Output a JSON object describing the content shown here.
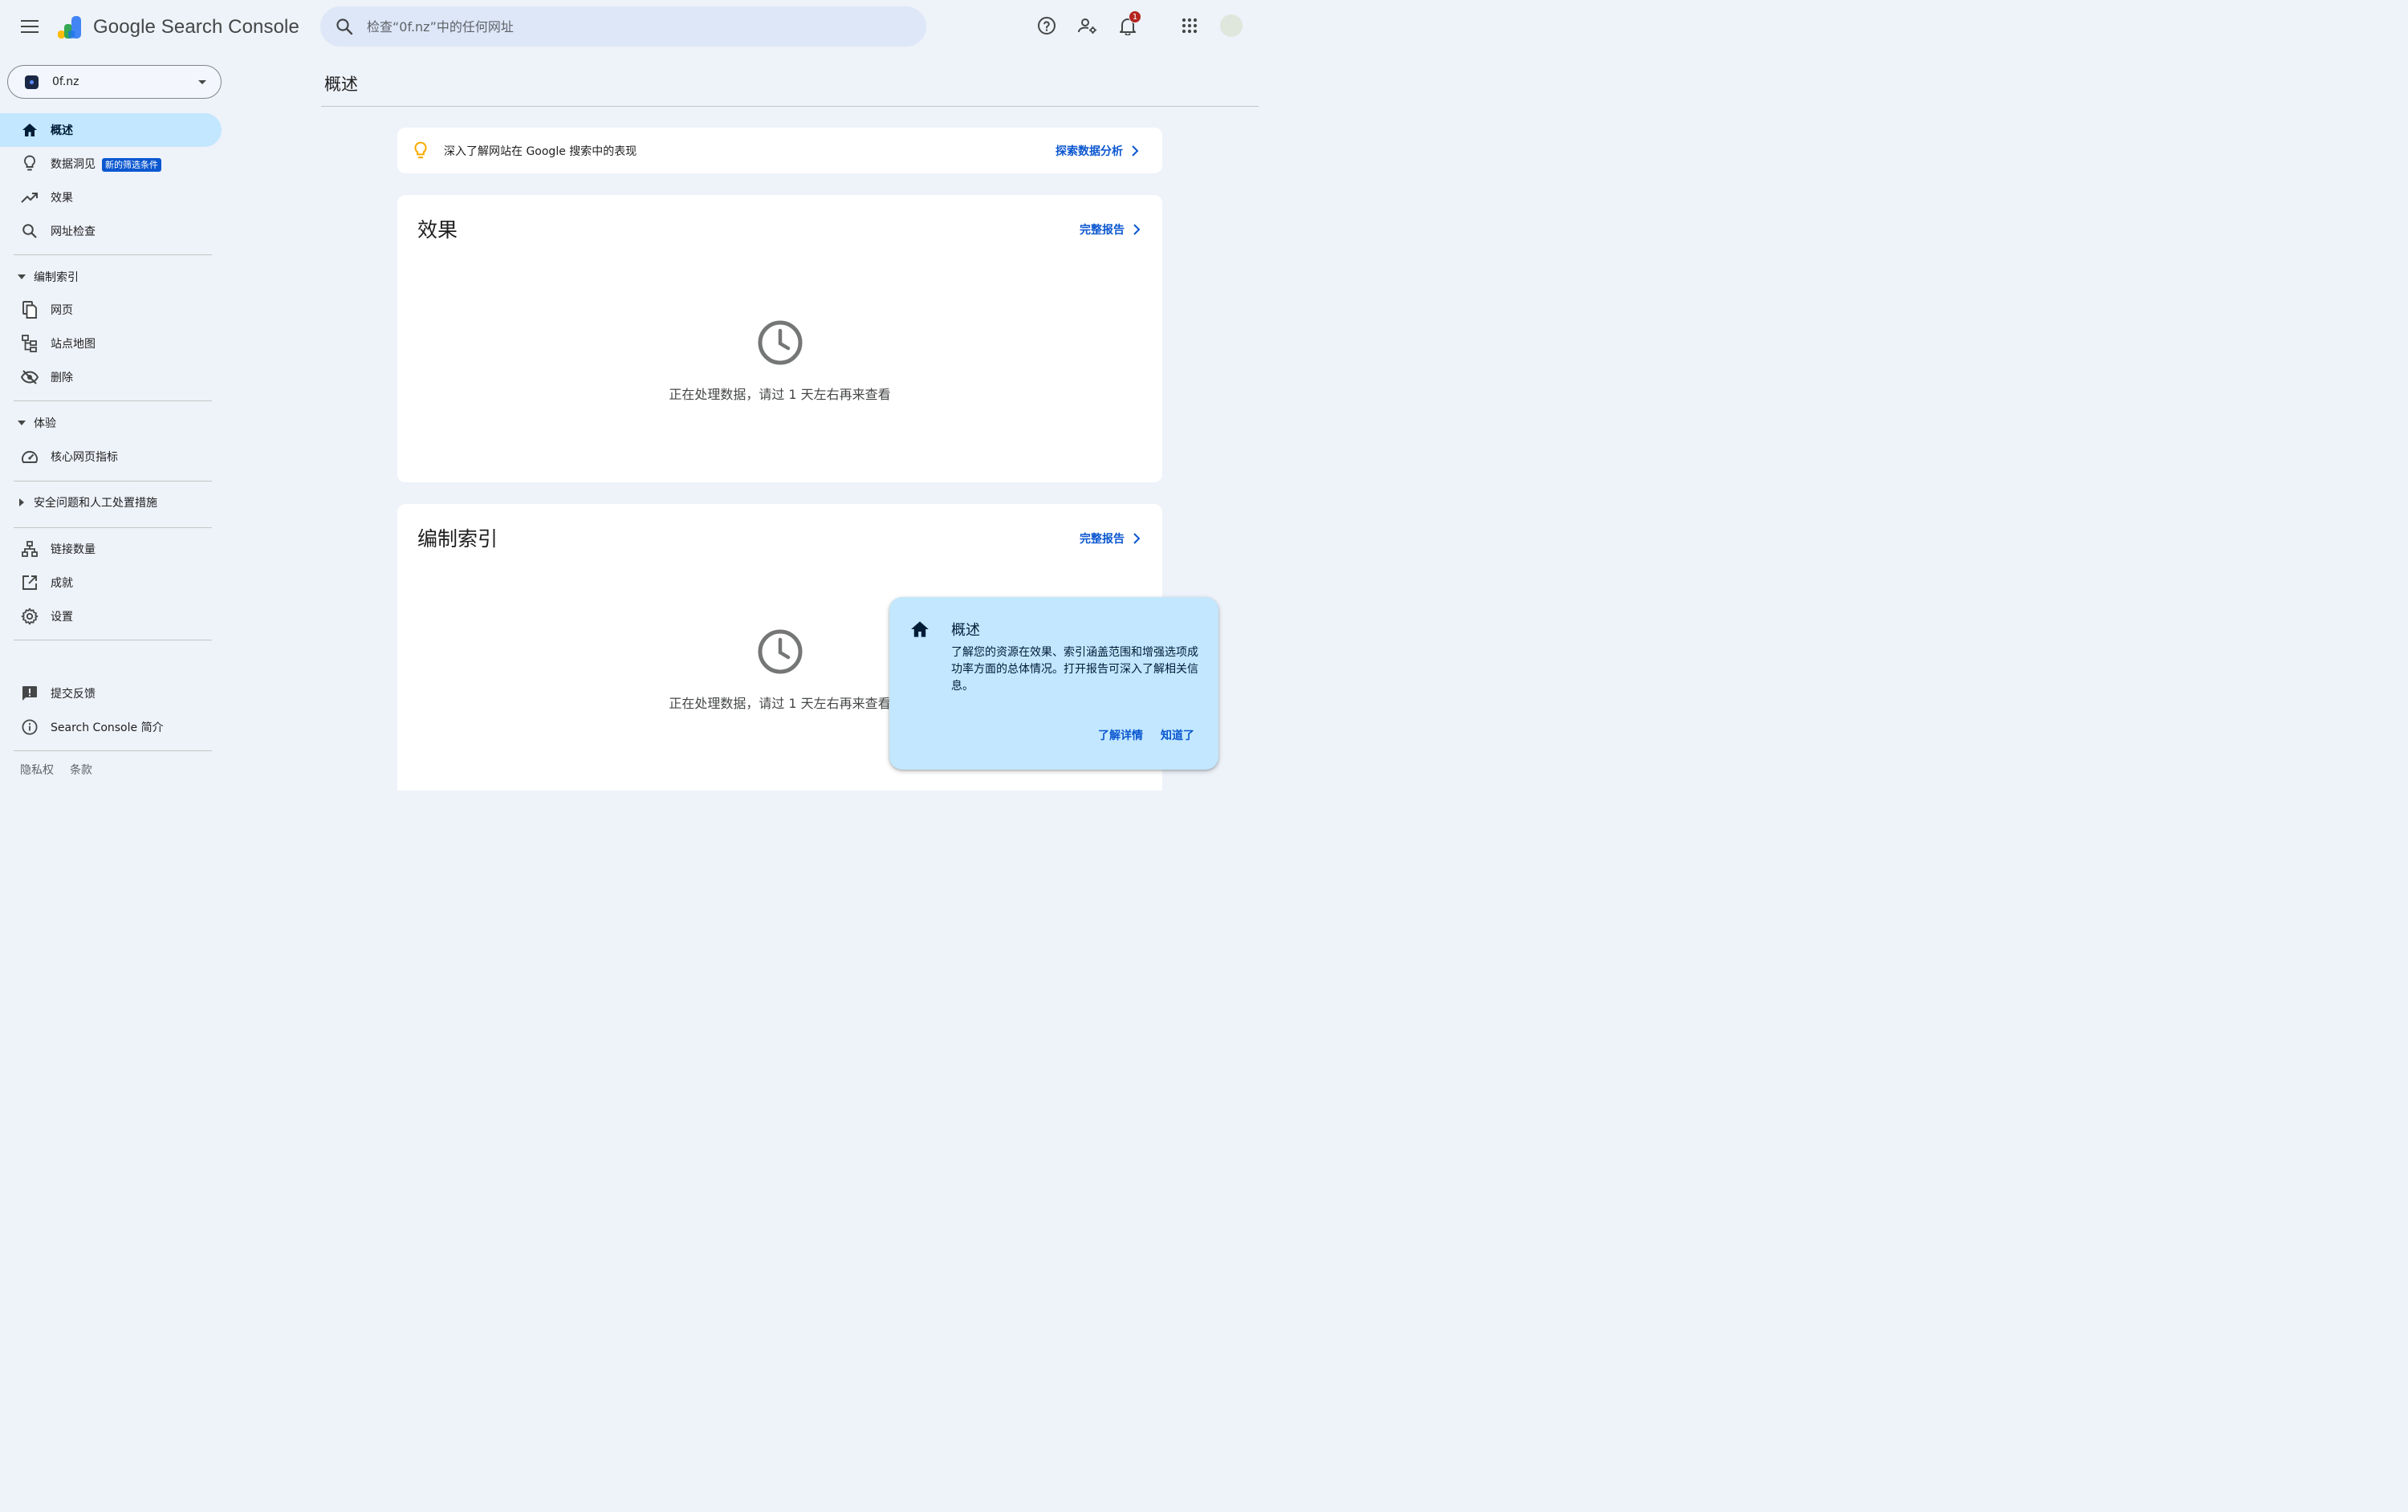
{
  "app": {
    "name": "Google Search Console"
  },
  "search": {
    "placeholder": "检查“0f.nz”中的任何网址"
  },
  "header": {
    "notification_count": "1"
  },
  "property": {
    "name": "0f.nz"
  },
  "sidebar": {
    "items": [
      {
        "label": "概述"
      },
      {
        "label": "数据洞见",
        "badge": "新的筛选条件"
      },
      {
        "label": "效果"
      },
      {
        "label": "网址检查"
      }
    ],
    "indexing": {
      "header": "编制索引",
      "items": [
        {
          "label": "网页"
        },
        {
          "label": "站点地图"
        },
        {
          "label": "删除"
        }
      ]
    },
    "experience": {
      "header": "体验",
      "items": [
        {
          "label": "核心网页指标"
        }
      ]
    },
    "security": {
      "header": "安全问题和人工处置措施"
    },
    "misc": [
      {
        "label": "链接数量"
      },
      {
        "label": "成就"
      },
      {
        "label": "设置"
      }
    ],
    "bottom": [
      {
        "label": "提交反馈"
      },
      {
        "label": "Search Console 简介"
      }
    ],
    "footer": {
      "privacy": "隐私权",
      "terms": "条款"
    }
  },
  "main": {
    "title": "概述",
    "insight": {
      "text": "深入了解网站在 Google 搜索中的表现",
      "link": "探索数据分析"
    },
    "cards": [
      {
        "title": "效果",
        "link": "完整报告",
        "message": "正在处理数据，请过 1 天左右再来查看"
      },
      {
        "title": "编制索引",
        "link": "完整报告",
        "message": "正在处理数据，请过 1 天左右再来查看"
      }
    ]
  },
  "popover": {
    "title": "概述",
    "body": "了解您的资源在效果、索引涵盖范围和增强选项成功率方面的总体情况。打开报告可深入了解相关信息。",
    "learn_more": "了解详情",
    "dismiss": "知道了"
  },
  "colors": {
    "accent": "#0b57d0",
    "active_nav": "#c2e7ff",
    "page_bg": "#eef2f9",
    "badge_red": "#b3261e"
  }
}
